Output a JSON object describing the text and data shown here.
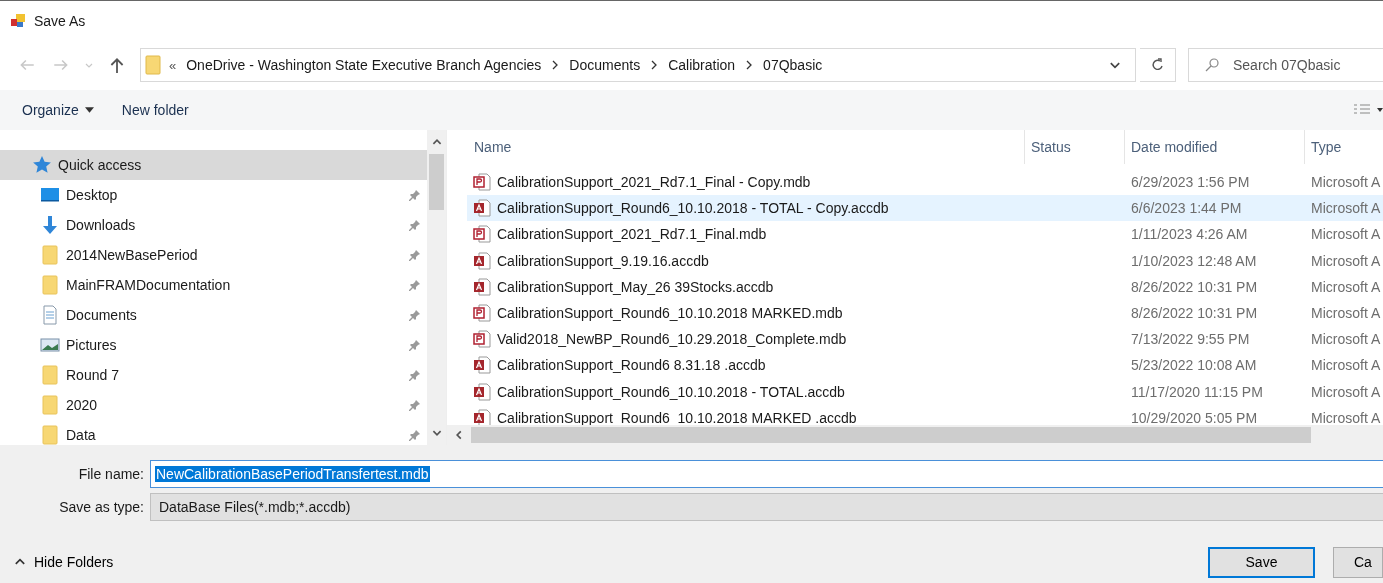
{
  "window": {
    "title": "Save As"
  },
  "address": {
    "overflow": "«",
    "segments": [
      "OneDrive - Washington State Executive Branch Agencies",
      "Documents",
      "Calibration",
      "07Qbasic"
    ]
  },
  "search": {
    "placeholder": "Search 07Qbasic"
  },
  "toolbar": {
    "organize": "Organize",
    "new_folder": "New folder"
  },
  "sidebar": {
    "items": [
      {
        "kind": "quick-access",
        "label": "Quick access",
        "selected": true,
        "pinned": false
      },
      {
        "kind": "desktop",
        "label": "Desktop",
        "selected": false,
        "pinned": true
      },
      {
        "kind": "downloads",
        "label": "Downloads",
        "selected": false,
        "pinned": true
      },
      {
        "kind": "folder",
        "label": "2014NewBasePeriod",
        "selected": false,
        "pinned": true
      },
      {
        "kind": "folder",
        "label": "MainFRAMDocumentation",
        "selected": false,
        "pinned": true
      },
      {
        "kind": "documents",
        "label": "Documents",
        "selected": false,
        "pinned": true
      },
      {
        "kind": "pictures",
        "label": "Pictures",
        "selected": false,
        "pinned": true
      },
      {
        "kind": "folder",
        "label": "Round 7",
        "selected": false,
        "pinned": true
      },
      {
        "kind": "folder",
        "label": "2020",
        "selected": false,
        "pinned": true
      },
      {
        "kind": "folder",
        "label": "Data",
        "selected": false,
        "pinned": true
      }
    ]
  },
  "table": {
    "columns": [
      "Name",
      "Status",
      "Date modified",
      "Type"
    ],
    "rows": [
      {
        "kind": "mdb",
        "name": "CalibrationSupport_2021_Rd7.1_Final - Copy.mdb",
        "date": "6/29/2023 1:56 PM",
        "type": "Microsoft A",
        "selected": false
      },
      {
        "kind": "accdb",
        "name": "CalibrationSupport_Round6_10.10.2018  - TOTAL - Copy.accdb",
        "date": "6/6/2023 1:44 PM",
        "type": "Microsoft A",
        "selected": true
      },
      {
        "kind": "mdb",
        "name": "CalibrationSupport_2021_Rd7.1_Final.mdb",
        "date": "1/11/2023 4:26 AM",
        "type": "Microsoft A",
        "selected": false
      },
      {
        "kind": "accdb",
        "name": "CalibrationSupport_9.19.16.accdb",
        "date": "1/10/2023 12:48 AM",
        "type": "Microsoft A",
        "selected": false
      },
      {
        "kind": "accdb",
        "name": "CalibrationSupport_May_26 39Stocks.accdb",
        "date": "8/26/2022 10:31 PM",
        "type": "Microsoft A",
        "selected": false
      },
      {
        "kind": "mdb",
        "name": "CalibrationSupport_Round6_10.10.2018 MARKED.mdb",
        "date": "8/26/2022 10:31 PM",
        "type": "Microsoft A",
        "selected": false
      },
      {
        "kind": "mdb",
        "name": "Valid2018_NewBP_Round6_10.29.2018_Complete.mdb",
        "date": "7/13/2022 9:55 PM",
        "type": "Microsoft A",
        "selected": false
      },
      {
        "kind": "accdb",
        "name": "CalibrationSupport_Round6 8.31.18 .accdb",
        "date": "5/23/2022 10:08 AM",
        "type": "Microsoft A",
        "selected": false
      },
      {
        "kind": "accdb",
        "name": "CalibrationSupport_Round6_10.10.2018  - TOTAL.accdb",
        "date": "11/17/2020 11:15 PM",
        "type": "Microsoft A",
        "selected": false
      },
      {
        "kind": "accdb",
        "name": "CalibrationSupport_Round6_10.10.2018 MARKED .accdb",
        "date": "10/29/2020 5:05 PM",
        "type": "Microsoft A",
        "selected": false
      }
    ]
  },
  "file_name": {
    "label": "File name:",
    "value": "NewCalibrationBasePeriodTransfertest.mdb"
  },
  "save_type": {
    "label": "Save as type:",
    "value": "DataBase Files(*.mdb;*.accdb)"
  },
  "hide_folders": "Hide Folders",
  "buttons": [
    "Save",
    "Ca"
  ]
}
